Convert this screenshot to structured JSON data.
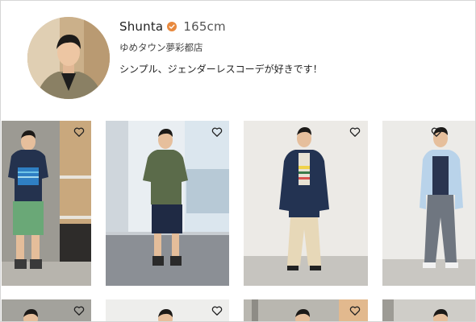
{
  "profile": {
    "name": "Shunta",
    "height": "165cm",
    "store": "ゆめタウン夢彩都店",
    "bio": "シンプル、ジェンダーレスコーデが好きです！"
  },
  "icons": {
    "verified": "verified-badge-icon",
    "favorite": "heart-outline-icon"
  },
  "colors": {
    "verified_badge": "#e8893e",
    "heart_stroke": "#222222"
  }
}
